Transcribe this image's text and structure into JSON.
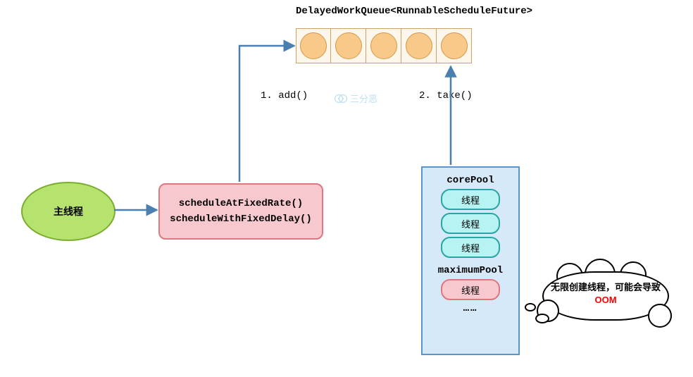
{
  "title": "DelayedWorkQueue<RunnableScheduleFuture>",
  "queue_slots": 5,
  "main_thread": "主线程",
  "schedule": {
    "line1": "scheduleAtFixedRate()",
    "line2": "scheduleWithFixedDelay()"
  },
  "ops": {
    "add": "1. add()",
    "take": "2. take()"
  },
  "pool": {
    "core_label": "corePool",
    "core_threads": [
      "线程",
      "线程",
      "线程"
    ],
    "max_label": "maximumPool",
    "max_threads": [
      "线程"
    ],
    "more": "……"
  },
  "cloud": {
    "prefix": "无限创建线程，可能会导致",
    "oom": "OOM"
  },
  "watermark": "三分恶",
  "arrow_color": "#4a7fb0"
}
